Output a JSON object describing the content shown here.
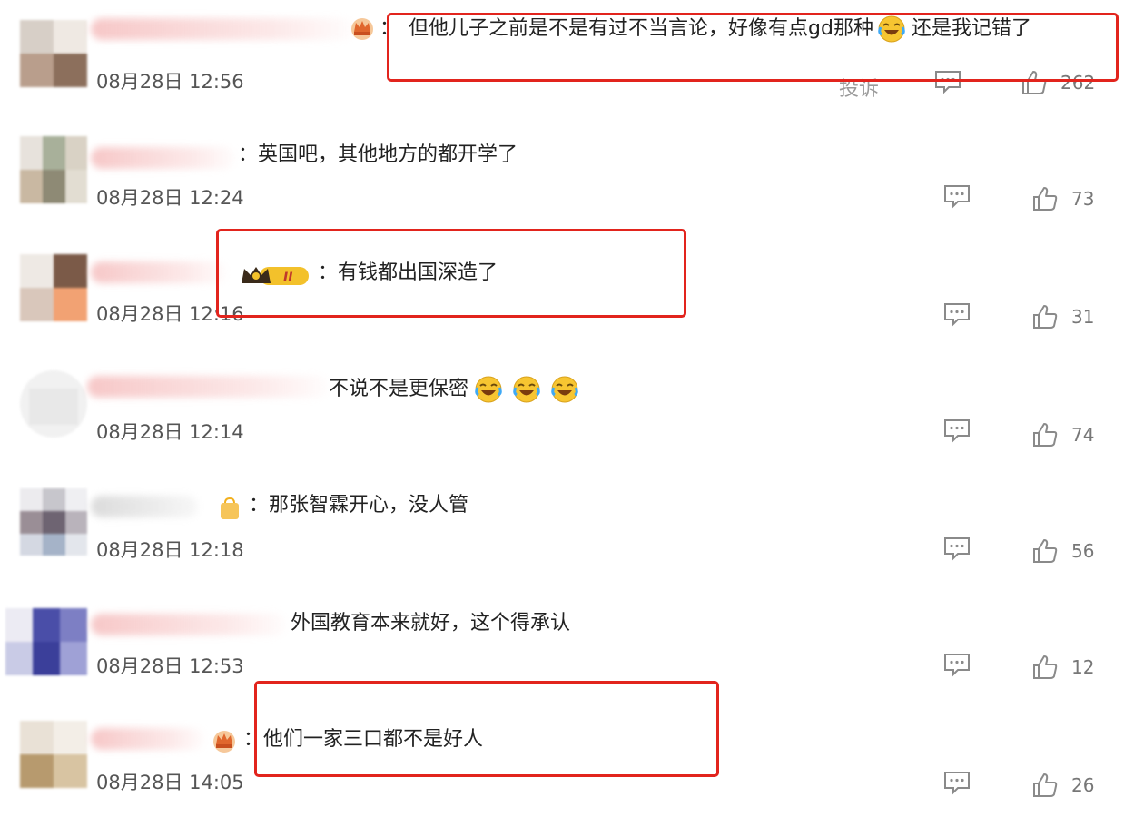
{
  "comments": [
    {
      "text": "但他儿子之前是不是有过不当言论，好像有点gd那种",
      "text_after_emoji": "还是我记错了",
      "time": "08月28日 12:56",
      "report_label": "投诉",
      "likes": "262",
      "emojis": [
        "laugh-cry-emoji"
      ]
    },
    {
      "text": "：英国吧，其他地方的都开学了",
      "time": "08月28日 12:24",
      "likes": "73"
    },
    {
      "text": "：有钱都出国深造了",
      "time": "08月28日 12:16",
      "likes": "31",
      "badge_level": "II"
    },
    {
      "text": "不说不是更保密",
      "time": "08月28日 12:14",
      "likes": "74",
      "emojis": [
        "laugh-cry-emoji",
        "laugh-cry-emoji",
        "laugh-cry-emoji"
      ]
    },
    {
      "text": "：那张智霖开心，没人管",
      "time": "08月28日 12:18",
      "likes": "56"
    },
    {
      "text": "外国教育本来就好，这个得承认",
      "time": "08月28日 12:53",
      "likes": "12"
    },
    {
      "text": "：他们一家三口都不是好人",
      "time": "08月28日 14:05",
      "likes": "26"
    }
  ],
  "colors": {
    "highlight_box": "#e2241d",
    "icon_gray": "#777777",
    "vip_gold": "#f2b01e"
  },
  "icons": {
    "reply": "comment-bubble-icon",
    "like": "thumbs-up-icon",
    "badge": "crown-badge-icon"
  }
}
